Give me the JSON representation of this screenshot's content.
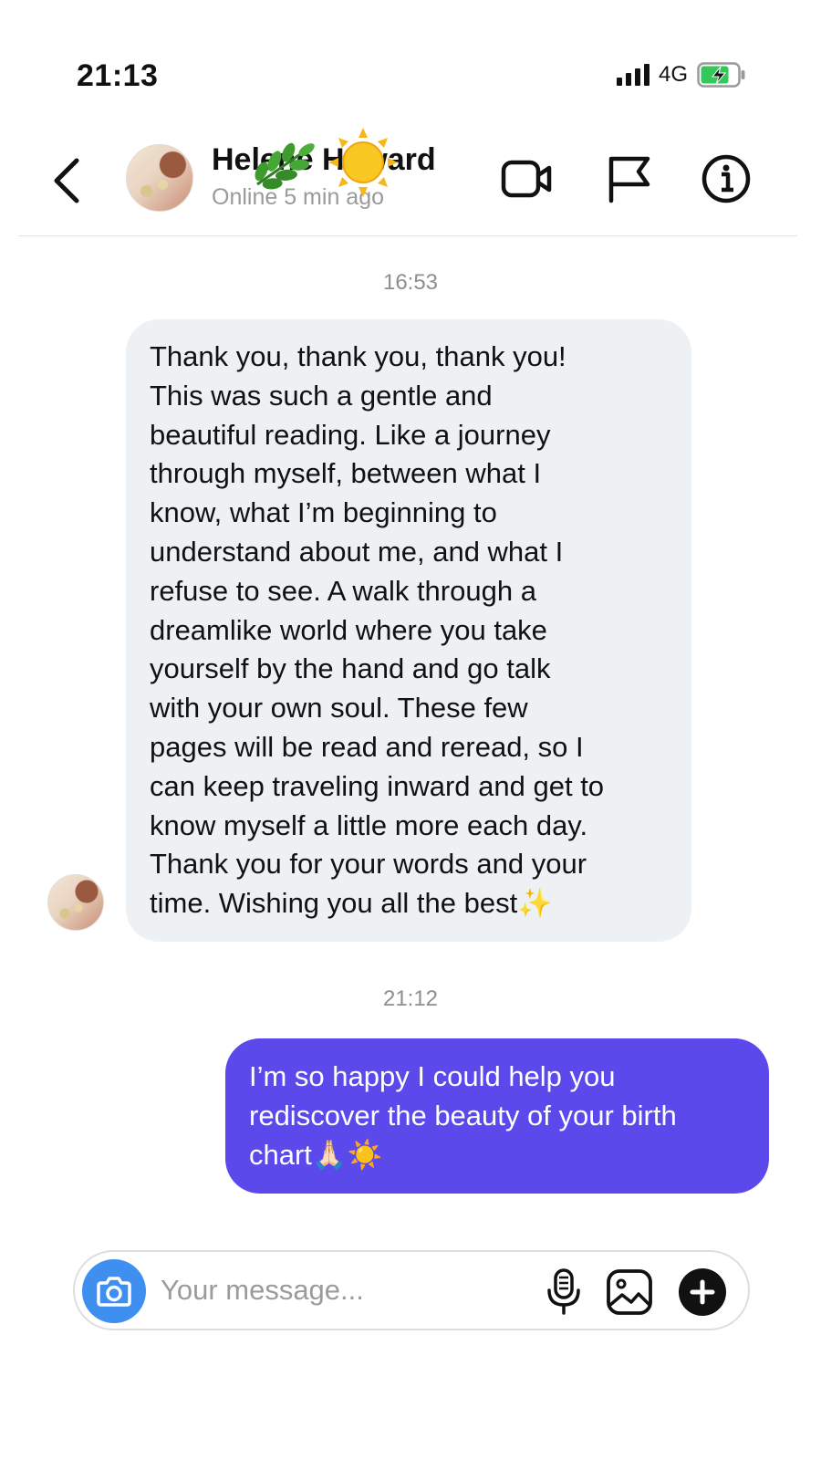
{
  "status_bar": {
    "time": "21:13",
    "network": "4G"
  },
  "header": {
    "contact_name": "Helene Howard",
    "contact_status": "Online 5 min ago",
    "icons": [
      "back-icon",
      "video-camera-icon",
      "flag-icon",
      "info-icon"
    ]
  },
  "conversation": {
    "messages": [
      {
        "timestamp": "16:53",
        "direction": "incoming",
        "text": "Thank you, thank you, thank you!\nThis was such a gentle and\nbeautiful reading. Like a journey\nthrough myself, between what I\nknow, what I’m beginning to\nunderstand about me, and what I\nrefuse to see. A walk through a\ndreamlike world where you take\nyourself by the hand and go talk\nwith your own soul. These few\npages will be read and reread, so I\ncan keep traveling inward and get to\nknow myself a little more each day.\nThank you for your words and your\ntime. Wishing you all the best✨"
      },
      {
        "timestamp": "21:12",
        "direction": "outgoing",
        "text": "I’m so happy I could help you\nrediscover the beauty of your birth\nchart🙏🏻☀️"
      }
    ]
  },
  "composer": {
    "placeholder": "Your message...",
    "value": "",
    "icons": [
      "camera-icon",
      "microphone-icon",
      "gallery-icon",
      "add-icon"
    ]
  },
  "colors": {
    "outgoing_bubble": "#5b49ec",
    "incoming_bubble": "#eef1f4",
    "camera_button": "#3f8ff0",
    "battery_charging": "#34c759"
  }
}
